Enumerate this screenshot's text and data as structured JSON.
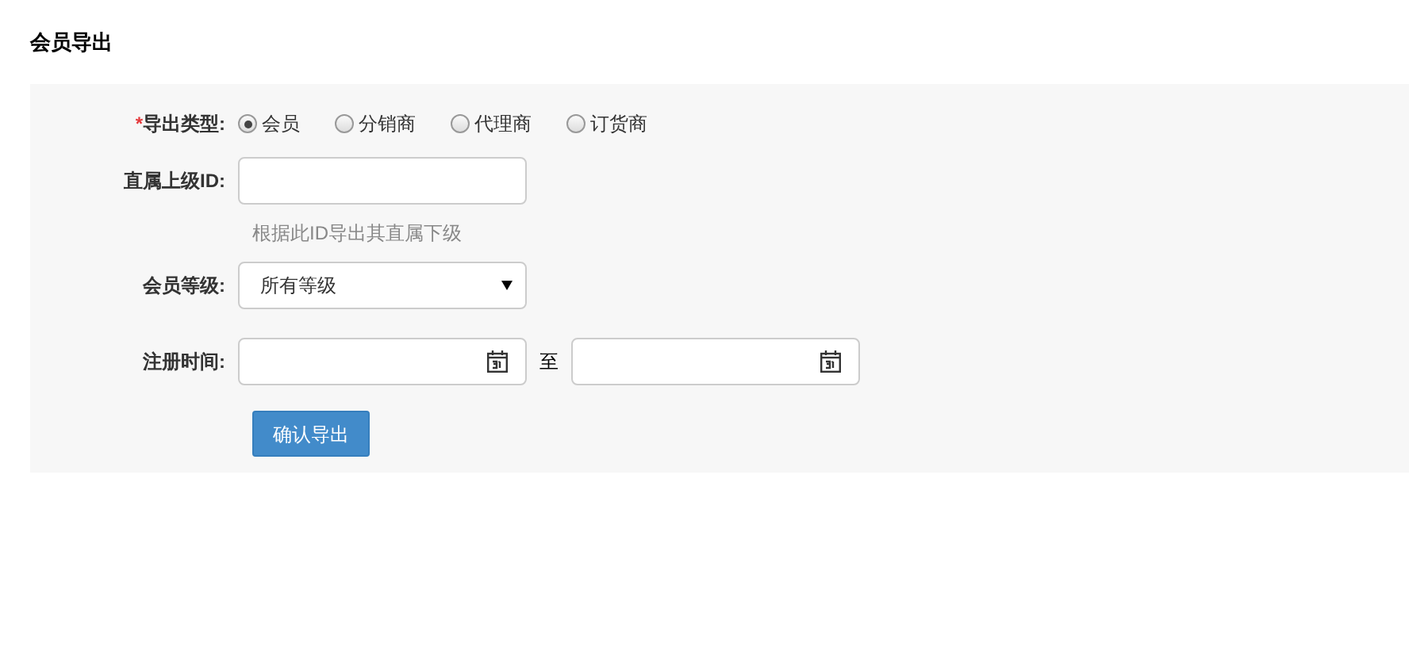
{
  "title": "会员导出",
  "form": {
    "export_type": {
      "label": "导出类型:",
      "required_mark": "*",
      "options": [
        {
          "label": "会员",
          "selected": true
        },
        {
          "label": "分销商",
          "selected": false
        },
        {
          "label": "代理商",
          "selected": false
        },
        {
          "label": "订货商",
          "selected": false
        }
      ]
    },
    "parent_id": {
      "label": "直属上级ID:",
      "hint": "根据此ID导出其直属下级"
    },
    "member_level": {
      "label": "会员等级:",
      "value": "所有等级"
    },
    "register_time": {
      "label": "注册时间:",
      "separator": "至"
    },
    "submit": {
      "label": "确认导出"
    }
  }
}
